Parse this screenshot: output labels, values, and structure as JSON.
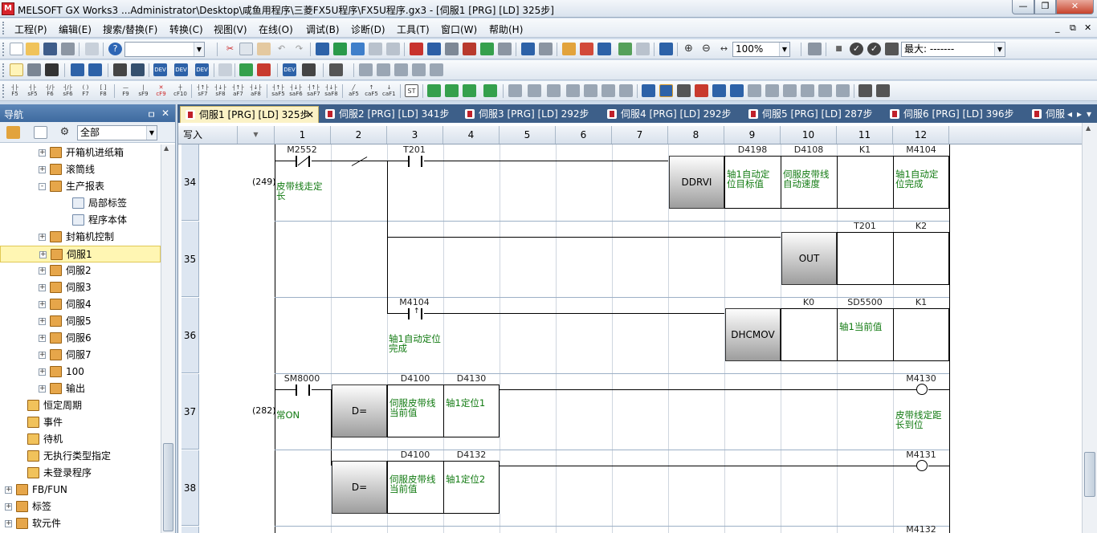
{
  "title": {
    "text": "MELSOFT GX Works3 ...Administrator\\Desktop\\咸鱼用程序\\三菱FX5U程序\\FX5U程序.gx3 - [伺服1 [PRG] [LD] 325步]",
    "icon": "melsoft-app-icon"
  },
  "window_buttons": {
    "minimize": "—",
    "maximize": "❐",
    "close": "✕"
  },
  "menubar": {
    "items": [
      "工程(P)",
      "编辑(E)",
      "搜索/替换(F)",
      "转换(C)",
      "视图(V)",
      "在线(O)",
      "调试(B)",
      "诊断(D)",
      "工具(T)",
      "窗口(W)",
      "帮助(H)"
    ],
    "mdi_buttons": [
      "_",
      "⧉",
      "✕"
    ]
  },
  "toolbar1": {
    "combo_blank": "",
    "zoom": "100%",
    "monitor_label": "最大: -------"
  },
  "toolbar3": {
    "keys": [
      "F5",
      "sF5",
      "F6",
      "sF6",
      "F7",
      "F8",
      "F9",
      "sF9",
      "cF9",
      "cF10",
      "sF7",
      "sF8",
      "aF7",
      "aF8",
      "saF5",
      "saF6",
      "saF7",
      "saF8",
      "aF5",
      "caF5",
      "caF10"
    ]
  },
  "nav": {
    "title": "导航",
    "pin": "ㅁ",
    "close": "✕",
    "filter": "全部",
    "tree": [
      {
        "label": "开箱机进纸箱",
        "indent": 48,
        "exp": "+",
        "icon": "program-folder-icon"
      },
      {
        "label": "滚筒线",
        "indent": 48,
        "exp": "+",
        "icon": "program-folder-icon"
      },
      {
        "label": "生产报表",
        "indent": 48,
        "exp": "-",
        "icon": "program-folder-icon"
      },
      {
        "label": "局部标签",
        "indent": 76,
        "exp": "",
        "icon": "local-label-icon"
      },
      {
        "label": "程序本体",
        "indent": 76,
        "exp": "",
        "icon": "program-body-icon"
      },
      {
        "label": "封箱机控制",
        "indent": 48,
        "exp": "+",
        "icon": "program-folder-icon"
      },
      {
        "label": "伺服1",
        "indent": 48,
        "exp": "+",
        "icon": "program-folder-icon",
        "selected": true
      },
      {
        "label": "伺服2",
        "indent": 48,
        "exp": "+",
        "icon": "program-folder-icon"
      },
      {
        "label": "伺服3",
        "indent": 48,
        "exp": "+",
        "icon": "program-folder-icon"
      },
      {
        "label": "伺服4",
        "indent": 48,
        "exp": "+",
        "icon": "program-folder-icon"
      },
      {
        "label": "伺服5",
        "indent": 48,
        "exp": "+",
        "icon": "program-folder-icon"
      },
      {
        "label": "伺服6",
        "indent": 48,
        "exp": "+",
        "icon": "program-folder-icon"
      },
      {
        "label": "伺服7",
        "indent": 48,
        "exp": "+",
        "icon": "program-folder-icon"
      },
      {
        "label": "100",
        "indent": 48,
        "exp": "+",
        "icon": "program-folder-icon"
      },
      {
        "label": "输出",
        "indent": 48,
        "exp": "+",
        "icon": "program-folder-icon"
      },
      {
        "label": "恒定周期",
        "indent": 20,
        "exp": "",
        "icon": "task-folder-icon"
      },
      {
        "label": "事件",
        "indent": 20,
        "exp": "",
        "icon": "task-folder-icon"
      },
      {
        "label": "待机",
        "indent": 20,
        "exp": "",
        "icon": "task-folder-icon"
      },
      {
        "label": "无执行类型指定",
        "indent": 20,
        "exp": "",
        "icon": "task-folder-icon"
      },
      {
        "label": "未登录程序",
        "indent": 20,
        "exp": "",
        "icon": "unregistered-folder-icon"
      },
      {
        "label": "FB/FUN",
        "indent": 6,
        "exp": "+",
        "icon": "fb-folder-icon"
      },
      {
        "label": "标签",
        "indent": 6,
        "exp": "+",
        "icon": "label-folder-icon"
      },
      {
        "label": "软元件",
        "indent": 6,
        "exp": "+",
        "icon": "device-folder-icon"
      }
    ]
  },
  "tabs": [
    {
      "label": "伺服1 [PRG] [LD] 325步",
      "active": true
    },
    {
      "label": "伺服2 [PRG] [LD] 341步"
    },
    {
      "label": "伺服3 [PRG] [LD] 292步"
    },
    {
      "label": "伺服4 [PRG] [LD] 292步"
    },
    {
      "label": "伺服5 [PRG] [LD] 287步"
    },
    {
      "label": "伺服6 [PRG] [LD] 396步"
    },
    {
      "label": "伺服"
    }
  ],
  "tab_close": "✕",
  "tab_nav": [
    "◂",
    "▸",
    "▾"
  ],
  "editor": {
    "mode": "写入",
    "columns": [
      "1",
      "2",
      "3",
      "4",
      "5",
      "6",
      "7",
      "8",
      "9",
      "10",
      "11",
      "12"
    ],
    "rungs": [
      {
        "number": "34",
        "step": "(249)"
      },
      {
        "number": "35",
        "step": ""
      },
      {
        "number": "36",
        "step": ""
      },
      {
        "number": "37",
        "step": "(282)"
      },
      {
        "number": "38",
        "step": ""
      }
    ],
    "devices": {
      "r34_c1": "M2552",
      "r34_c3": "T201",
      "r34_c1_cmt": "皮带线走定长",
      "r34_ins": "DDRVI",
      "r34_op1": "D4198",
      "r34_op1_cmt": "轴1自动定位目标值",
      "r34_op2": "D4108",
      "r34_op2_cmt": "伺服皮带线自动速度",
      "r34_op3": "K1",
      "r34_op4": "M4104",
      "r34_op4_cmt": "轴1自动定位完成",
      "r35_ins": "OUT",
      "r35_op1": "T201",
      "r35_op2": "K2",
      "r36_c3": "M4104",
      "r36_c3_cmt": "轴1自动定位完成",
      "r36_ins": "DHCMOV",
      "r36_op1": "K0",
      "r36_op2": "SD5500",
      "r36_op2_cmt": "轴1当前值",
      "r36_op3": "K1",
      "r37_c1": "SM8000",
      "r37_c1_cmt": "常ON",
      "r37_ins": "D=",
      "r37_op1": "D4100",
      "r37_op1_cmt": "伺服皮带线当前值",
      "r37_op2": "D4130",
      "r37_op2_cmt": "轴1定位1",
      "r37_coil": "M4130",
      "r37_coil_cmt": "皮带线定距长到位",
      "r38_ins": "D=",
      "r38_op1": "D4100",
      "r38_op1_cmt": "伺服皮带线当前值",
      "r38_op2": "D4132",
      "r38_op2_cmt": "轴1定位2",
      "r38_coil": "M4131",
      "r39_coil": "M4132"
    }
  }
}
